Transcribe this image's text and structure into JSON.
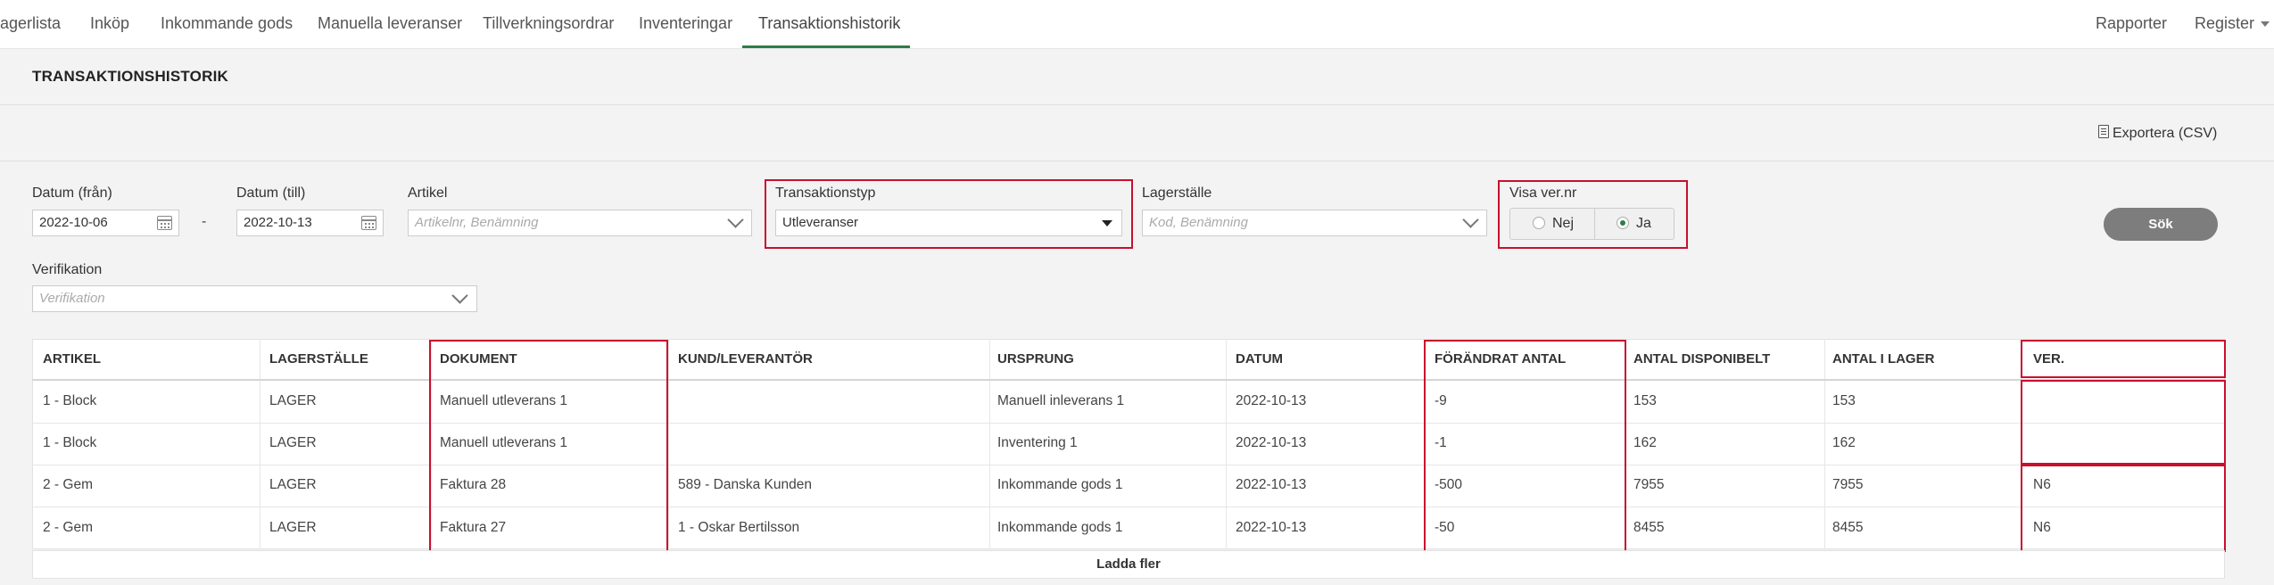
{
  "nav": {
    "items": [
      {
        "label": "agerlista"
      },
      {
        "label": "Inköp"
      },
      {
        "label": "Inkommande gods"
      },
      {
        "label": "Manuella leveranser"
      },
      {
        "label": "Tillverkningsordrar"
      },
      {
        "label": "Inventeringar"
      },
      {
        "label": "Transaktionshistorik",
        "active": true
      }
    ],
    "right": {
      "reports": "Rapporter",
      "register": "Register"
    }
  },
  "page": {
    "title": "TRANSAKTIONSHISTORIK",
    "export_label": "Exportera (CSV)"
  },
  "filters": {
    "date_from": {
      "label": "Datum (från)",
      "value": "2022-10-06"
    },
    "date_sep": "-",
    "date_to": {
      "label": "Datum (till)",
      "value": "2022-10-13"
    },
    "article": {
      "label": "Artikel",
      "placeholder": "Artikelnr, Benämning"
    },
    "transaction_type": {
      "label": "Transaktionstyp",
      "value": "Utleveranser"
    },
    "location": {
      "label": "Lagerställe",
      "placeholder": "Kod, Benämning"
    },
    "show_ver": {
      "label": "Visa ver.nr",
      "options": [
        "Nej",
        "Ja"
      ],
      "selected": "Ja"
    },
    "verification": {
      "label": "Verifikation",
      "placeholder": "Verifikation"
    },
    "search_button": "Sök"
  },
  "table": {
    "columns": [
      "ARTIKEL",
      "LAGERSTÄLLE",
      "DOKUMENT",
      "KUND/LEVERANTÖR",
      "URSPRUNG",
      "DATUM",
      "FÖRÄNDRAT ANTAL",
      "ANTAL DISPONIBELT",
      "ANTAL I LAGER",
      "VER."
    ],
    "rows": [
      [
        "1 - Block",
        "LAGER",
        "Manuell utleverans 1",
        "",
        "Manuell inleverans 1",
        "2022-10-13",
        "-9",
        "153",
        "153",
        ""
      ],
      [
        "1 - Block",
        "LAGER",
        "Manuell utleverans 1",
        "",
        "Inventering 1",
        "2022-10-13",
        "-1",
        "162",
        "162",
        ""
      ],
      [
        "2 - Gem",
        "LAGER",
        "Faktura 28",
        "589 - Danska Kunden",
        "Inkommande gods 1",
        "2022-10-13",
        "-500",
        "7955",
        "7955",
        "N6"
      ],
      [
        "2 - Gem",
        "LAGER",
        "Faktura 27",
        "1 - Oskar Bertilsson",
        "Inkommande gods 1",
        "2022-10-13",
        "-50",
        "8455",
        "8455",
        "N6"
      ]
    ],
    "load_more": "Ladda fler"
  },
  "colors": {
    "accent": "#2e7d45",
    "highlight": "#c8102e",
    "search_button": "#7d7d7d"
  }
}
